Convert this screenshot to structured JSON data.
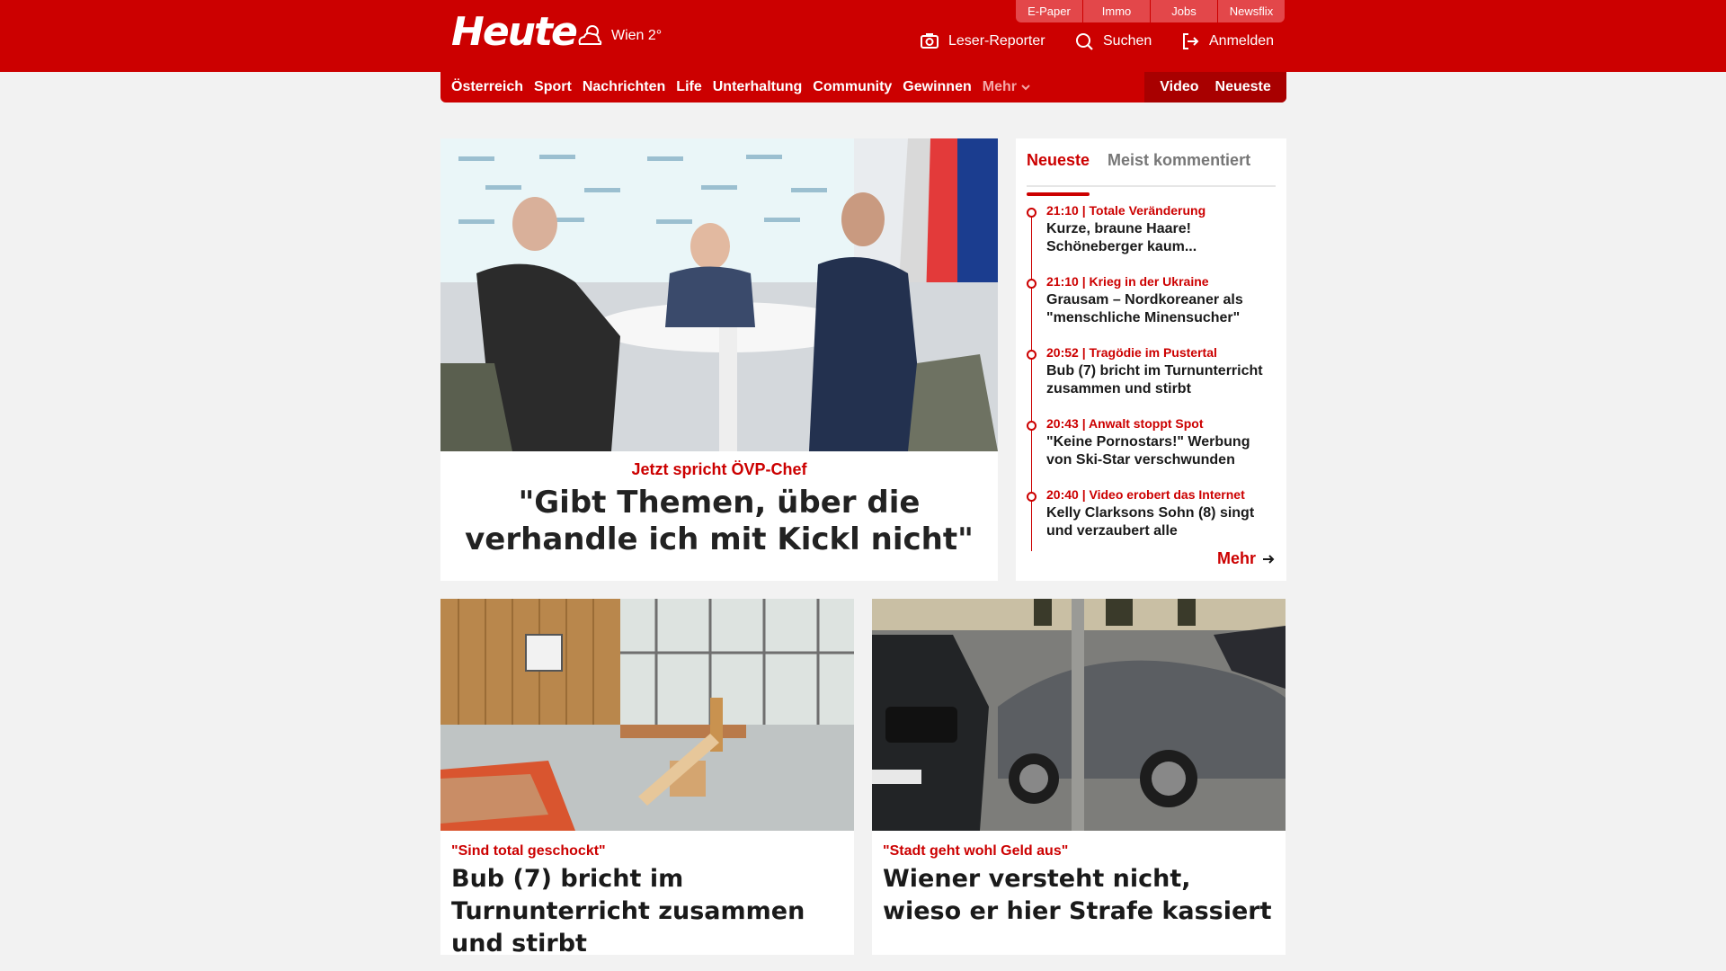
{
  "header": {
    "logo": "Heute",
    "weather": {
      "city_temp": "Wien 2°",
      "icon": "cloud-sun-icon"
    },
    "service_tabs": [
      "E-Paper",
      "Immo",
      "Jobs",
      "Newsflix"
    ],
    "actions": {
      "reporter": "Leser-Reporter",
      "search": "Suchen",
      "login": "Anmelden"
    }
  },
  "nav": {
    "items": [
      "Österreich",
      "Sport",
      "Nachrichten",
      "Life",
      "Unterhaltung",
      "Community",
      "Gewinnen"
    ],
    "more": "Mehr",
    "video": "Video",
    "latest": "Neueste"
  },
  "hero": {
    "kicker": "Jetzt spricht ÖVP-Chef",
    "title": "\"Gibt Themen, über die verhandle ich mit Kickl nicht\""
  },
  "sidebar": {
    "tabs": [
      "Neueste",
      "Meist kommentiert"
    ],
    "items": [
      {
        "meta": "21:10 | Totale Veränderung",
        "title": "Kurze, braune Haare! Schöneberger kaum..."
      },
      {
        "meta": "21:10 | Krieg in der Ukraine",
        "title": "Grausam – Nordkoreaner als \"menschliche Minensucher\""
      },
      {
        "meta": "20:52 | Tragödie im Pustertal",
        "title": "Bub (7) bricht im Turnunterricht zusammen und stirbt"
      },
      {
        "meta": "20:43 | Anwalt stoppt Spot",
        "title": "\"Keine Pornostars!\" Werbung von Ski-Star verschwunden"
      },
      {
        "meta": "20:40 | Video erobert das Internet",
        "title": "Kelly Clarksons Sohn (8) singt und verzaubert alle"
      }
    ],
    "more": "Mehr"
  },
  "cards": [
    {
      "kicker": "\"Sind total geschockt\"",
      "title": "Bub (7) bricht im Turnunterricht zusammen und stirbt"
    },
    {
      "kicker": "\"Stadt geht wohl Geld aus\"",
      "title": "Wiener versteht nicht, wieso er hier Strafe kassiert"
    }
  ],
  "colors": {
    "brand": "#cc0000",
    "brand_dark": "#a80000",
    "background": "#f2f2f2"
  }
}
